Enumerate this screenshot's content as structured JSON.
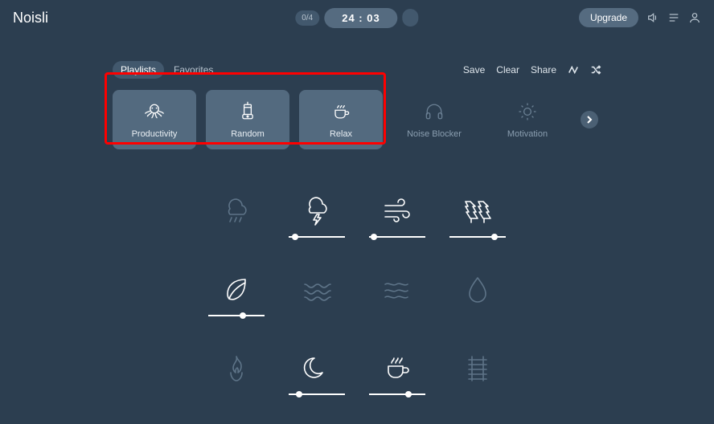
{
  "header": {
    "logo": "Noisli",
    "count": "0/4",
    "timer": "24 : 03",
    "upgrade": "Upgrade"
  },
  "tabs": {
    "playlists": "Playlists",
    "favorites": "Favorites"
  },
  "actions": {
    "save": "Save",
    "clear": "Clear",
    "share": "Share"
  },
  "playlists": [
    {
      "label": "Productivity"
    },
    {
      "label": "Random"
    },
    {
      "label": "Relax"
    },
    {
      "label": "Noise Blocker"
    },
    {
      "label": "Motivation"
    }
  ],
  "sounds": [
    {
      "name": "rain",
      "active": false,
      "slider": null
    },
    {
      "name": "thunder",
      "active": true,
      "slider": 12
    },
    {
      "name": "wind",
      "active": true,
      "slider": 8
    },
    {
      "name": "forest",
      "active": true,
      "slider": 80
    },
    {
      "name": "leaves",
      "active": true,
      "slider": 62
    },
    {
      "name": "waves",
      "active": false,
      "slider": null
    },
    {
      "name": "stream",
      "active": false,
      "slider": null
    },
    {
      "name": "water-drop",
      "active": false,
      "slider": null
    },
    {
      "name": "fire",
      "active": false,
      "slider": null
    },
    {
      "name": "night",
      "active": true,
      "slider": 18
    },
    {
      "name": "coffee",
      "active": true,
      "slider": 70
    },
    {
      "name": "train",
      "active": false,
      "slider": null
    }
  ]
}
